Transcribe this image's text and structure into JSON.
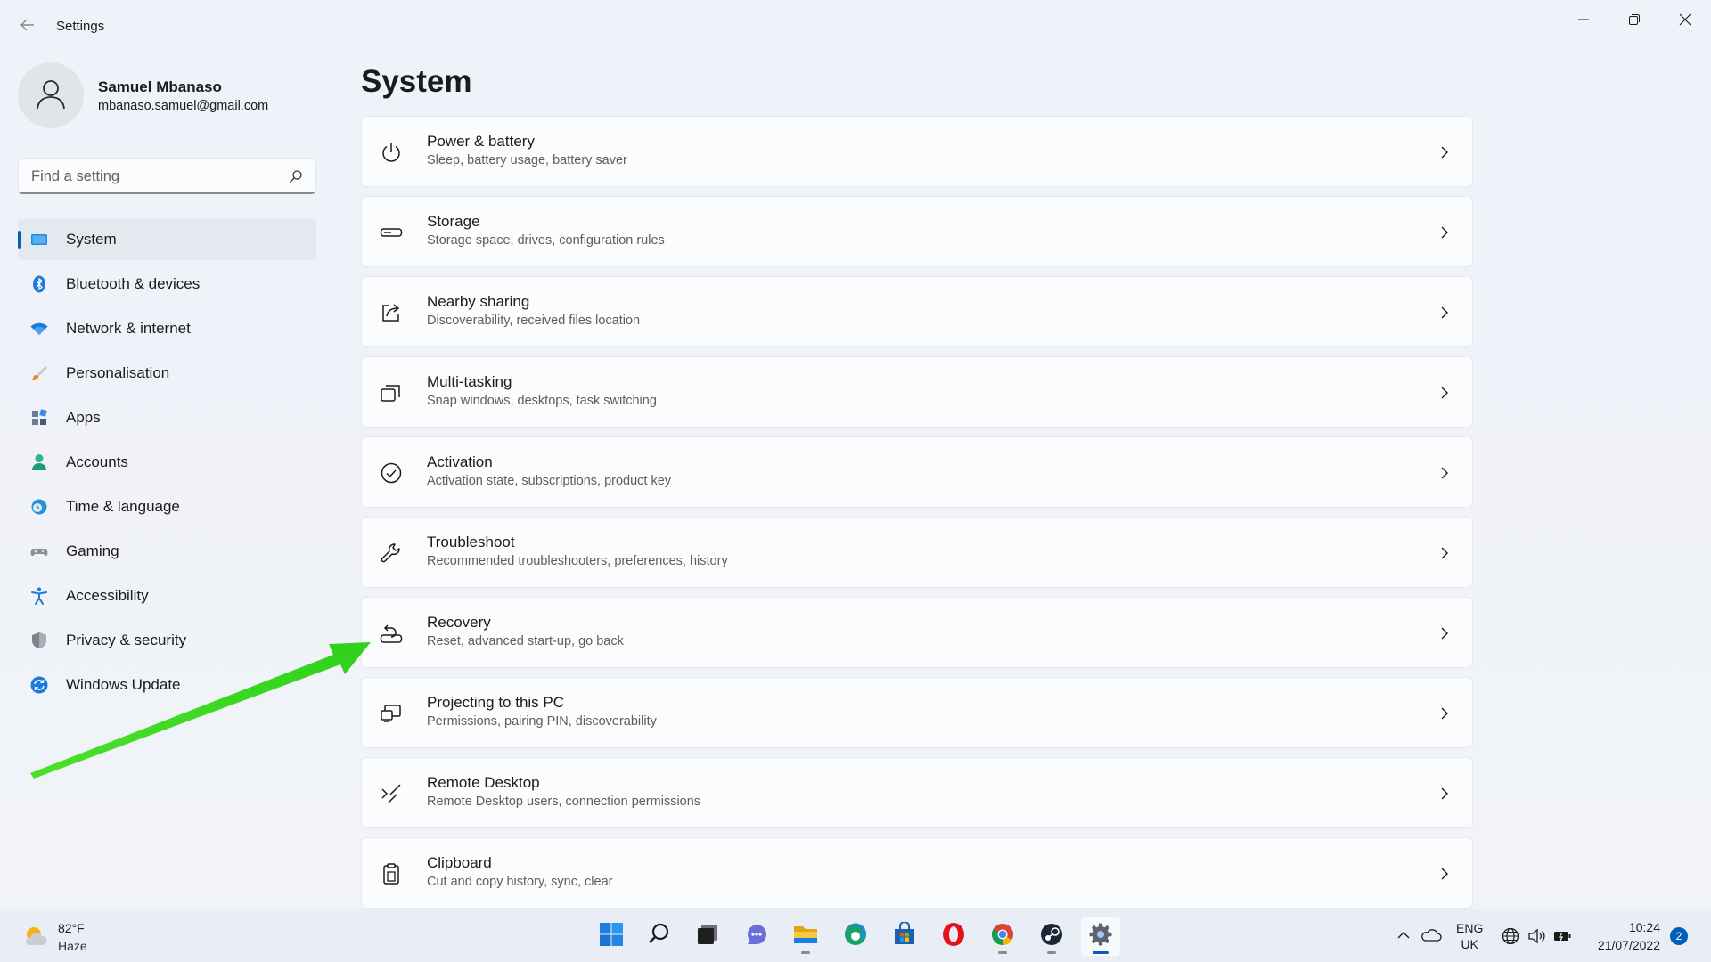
{
  "window": {
    "title": "Settings",
    "back_icon": "back-arrow-icon",
    "controls": [
      "minimize-icon",
      "maximize-icon",
      "close-icon"
    ]
  },
  "profile": {
    "name": "Samuel Mbanaso",
    "email": "mbanaso.samuel@gmail.com",
    "avatar_icon": "person-icon"
  },
  "search": {
    "placeholder": "Find a setting",
    "icon": "search-icon"
  },
  "sidebar": {
    "items": [
      {
        "label": "System",
        "icon": "system-icon",
        "selected": true
      },
      {
        "label": "Bluetooth & devices",
        "icon": "bluetooth-icon"
      },
      {
        "label": "Network & internet",
        "icon": "wifi-icon"
      },
      {
        "label": "Personalisation",
        "icon": "brush-icon"
      },
      {
        "label": "Apps",
        "icon": "apps-icon"
      },
      {
        "label": "Accounts",
        "icon": "accounts-icon"
      },
      {
        "label": "Time & language",
        "icon": "time-language-icon"
      },
      {
        "label": "Gaming",
        "icon": "gaming-icon"
      },
      {
        "label": "Accessibility",
        "icon": "accessibility-icon"
      },
      {
        "label": "Privacy & security",
        "icon": "shield-icon"
      },
      {
        "label": "Windows Update",
        "icon": "update-icon"
      }
    ]
  },
  "main": {
    "title": "System",
    "cards": [
      {
        "title": "Power & battery",
        "desc": "Sleep, battery usage, battery saver",
        "icon": "power-icon"
      },
      {
        "title": "Storage",
        "desc": "Storage space, drives, configuration rules",
        "icon": "storage-icon"
      },
      {
        "title": "Nearby sharing",
        "desc": "Discoverability, received files location",
        "icon": "share-icon"
      },
      {
        "title": "Multi-tasking",
        "desc": "Snap windows, desktops, task switching",
        "icon": "multitasking-icon"
      },
      {
        "title": "Activation",
        "desc": "Activation state, subscriptions, product key",
        "icon": "check-circle-icon"
      },
      {
        "title": "Troubleshoot",
        "desc": "Recommended troubleshooters, preferences, history",
        "icon": "wrench-icon"
      },
      {
        "title": "Recovery",
        "desc": "Reset, advanced start-up, go back",
        "icon": "recovery-icon"
      },
      {
        "title": "Projecting to this PC",
        "desc": "Permissions, pairing PIN, discoverability",
        "icon": "projecting-icon"
      },
      {
        "title": "Remote Desktop",
        "desc": "Remote Desktop users, connection permissions",
        "icon": "remote-desktop-icon"
      },
      {
        "title": "Clipboard",
        "desc": "Cut and copy history, sync, clear",
        "icon": "clipboard-icon"
      }
    ]
  },
  "annotation": {
    "type": "arrow",
    "color": "#3ee01e",
    "points_to": "Recovery"
  },
  "taskbar": {
    "weather": {
      "temp": "82°F",
      "condition": "Haze",
      "icon": "weather-sun-cloud-icon"
    },
    "apps": [
      {
        "name": "start",
        "icon": "windows-start-icon"
      },
      {
        "name": "search",
        "icon": "taskbar-search-icon"
      },
      {
        "name": "task-view",
        "icon": "task-view-icon"
      },
      {
        "name": "chat",
        "icon": "teams-chat-icon"
      },
      {
        "name": "file-explorer",
        "icon": "folder-icon",
        "running": true
      },
      {
        "name": "edge",
        "icon": "edge-icon"
      },
      {
        "name": "store",
        "icon": "store-icon"
      },
      {
        "name": "opera",
        "icon": "opera-icon"
      },
      {
        "name": "chrome",
        "icon": "chrome-icon",
        "running": true
      },
      {
        "name": "steam",
        "icon": "steam-icon",
        "running": true
      },
      {
        "name": "settings",
        "icon": "settings-gear-icon",
        "active": true
      }
    ],
    "tray": {
      "lang_top": "ENG",
      "lang_bottom": "UK",
      "time": "10:24",
      "date": "21/07/2022",
      "notifications": "2"
    }
  },
  "colors": {
    "accent": "#005fb8",
    "arrow": "#3ee01e"
  }
}
